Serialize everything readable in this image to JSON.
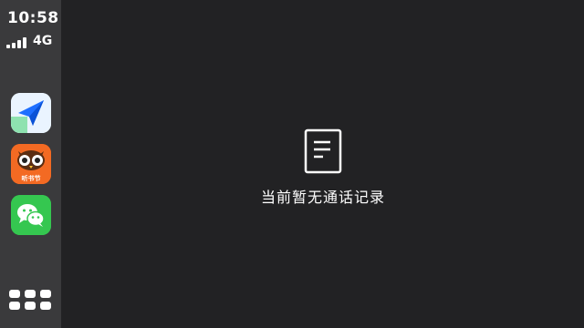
{
  "status_bar": {
    "time": "10:58",
    "network": "4G"
  },
  "sidebar": {
    "apps": [
      {
        "name": "maps-app",
        "icon": "navigation-arrow-icon"
      },
      {
        "name": "audio-book-app",
        "icon": "owl-icon",
        "label": "听书节"
      },
      {
        "name": "wechat-app",
        "icon": "wechat-bubbles-icon"
      }
    ],
    "home_button_icon": "app-grid-icon"
  },
  "main": {
    "empty_icon": "document-icon",
    "empty_message": "当前暂无通话记录"
  },
  "colors": {
    "background": "#222224",
    "sidebar": "#3a3a3c",
    "maps": "#1e6fff",
    "audio": "#f36a23",
    "wechat": "#35c750"
  }
}
